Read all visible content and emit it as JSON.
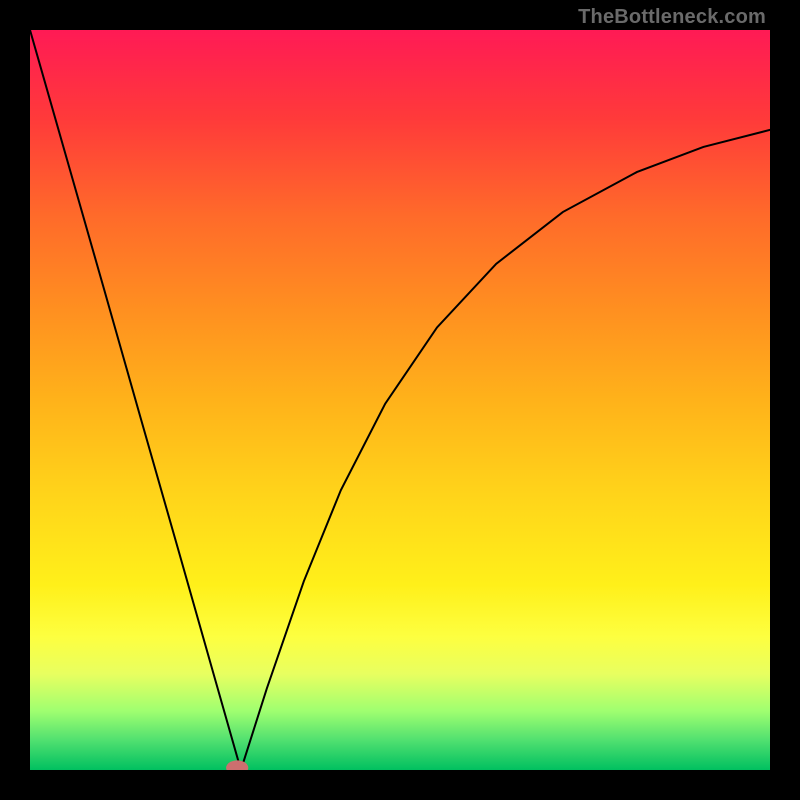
{
  "watermark": "TheBottleneck.com",
  "colors": {
    "background": "#000000",
    "gradient_top": "#ff1a55",
    "gradient_bottom": "#00c060",
    "curve": "#000000",
    "marker": "#cc6f6f"
  },
  "chart_data": {
    "type": "line",
    "title": "",
    "xlabel": "",
    "ylabel": "",
    "xlim": [
      0,
      1
    ],
    "ylim": [
      0,
      1
    ],
    "grid": false,
    "legend": false,
    "description": "V-shaped bottleneck curve on a red-to-green vertical gradient. Left branch falls steeply from upper-left to a minimum near x≈0.285; right branch rises with diminishing slope toward upper-right. A small salmon marker sits at the minimum.",
    "minimum": {
      "x": 0.285,
      "y": 0.0
    },
    "series": [
      {
        "name": "bottleneck-curve",
        "x": [
          0.0,
          0.05,
          0.1,
          0.15,
          0.2,
          0.25,
          0.285,
          0.32,
          0.37,
          0.42,
          0.48,
          0.55,
          0.63,
          0.72,
          0.82,
          0.91,
          1.0
        ],
        "y": [
          1.0,
          0.825,
          0.65,
          0.474,
          0.299,
          0.123,
          0.0,
          0.11,
          0.255,
          0.378,
          0.495,
          0.598,
          0.684,
          0.754,
          0.808,
          0.842,
          0.865
        ]
      }
    ],
    "annotations": [
      {
        "type": "marker",
        "shape": "ellipse",
        "x": 0.28,
        "y": 0.003,
        "rx": 0.015,
        "ry": 0.01
      }
    ]
  }
}
